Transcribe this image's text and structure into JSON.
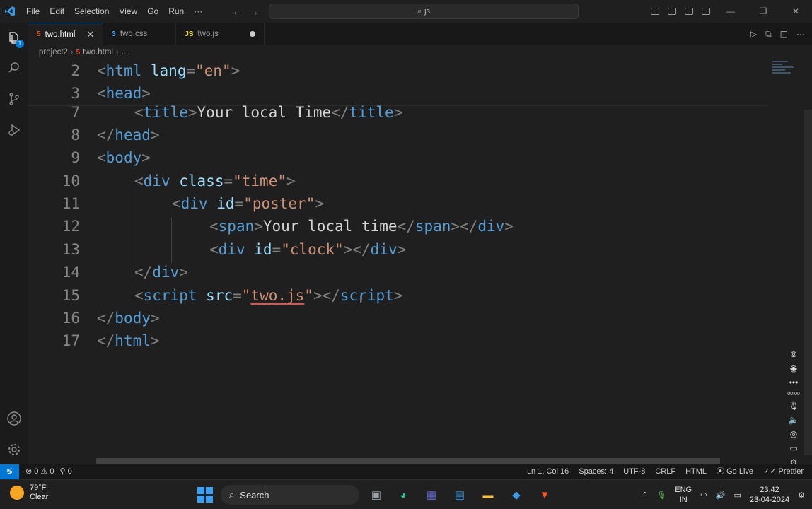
{
  "menu": [
    "File",
    "Edit",
    "Selection",
    "View",
    "Go",
    "Run",
    "···"
  ],
  "search": {
    "text": "js"
  },
  "tabs": [
    {
      "label": "two.html",
      "icon": "html-file-icon",
      "icon_color": "#e44d26"
    },
    {
      "label": "two.css",
      "icon": "css-file-icon",
      "icon_color": "#42a5f5"
    },
    {
      "label": "two.js",
      "icon": "js-file-icon",
      "icon_color": "#f1dd35"
    }
  ],
  "breadcrumb": {
    "folder": "project2",
    "file": "two.html",
    "more": "..."
  },
  "editor": {
    "lines": [
      {
        "n": "2",
        "indent": 0,
        "tokens": [
          [
            "p",
            "<"
          ],
          [
            "tag",
            "html"
          ],
          [
            "text",
            " "
          ],
          [
            "attr",
            "lang"
          ],
          [
            "p",
            "="
          ],
          [
            "str",
            "\"en\""
          ],
          [
            "p",
            ">"
          ]
        ]
      },
      {
        "n": "3",
        "indent": 0,
        "tokens": [
          [
            "p",
            "<"
          ],
          [
            "tag",
            "head"
          ],
          [
            "p",
            ">"
          ]
        ]
      },
      {
        "n": "7",
        "indent": 1,
        "tokens": [
          [
            "p",
            "<"
          ],
          [
            "tag",
            "title"
          ],
          [
            "p",
            ">"
          ],
          [
            "text",
            "Your local Time"
          ],
          [
            "p",
            "</"
          ],
          [
            "tag",
            "title"
          ],
          [
            "p",
            ">"
          ]
        ]
      },
      {
        "n": "8",
        "indent": 0,
        "tokens": [
          [
            "p",
            "</"
          ],
          [
            "tag",
            "head"
          ],
          [
            "p",
            ">"
          ]
        ]
      },
      {
        "n": "9",
        "indent": 0,
        "tokens": [
          [
            "p",
            "<"
          ],
          [
            "tag",
            "body"
          ],
          [
            "p",
            ">"
          ]
        ]
      },
      {
        "n": "10",
        "indent": 1,
        "tokens": [
          [
            "p",
            "<"
          ],
          [
            "tag",
            "div"
          ],
          [
            "text",
            " "
          ],
          [
            "attr",
            "class"
          ],
          [
            "p",
            "="
          ],
          [
            "str",
            "\"time\""
          ],
          [
            "p",
            ">"
          ]
        ]
      },
      {
        "n": "11",
        "indent": 2,
        "tokens": [
          [
            "p",
            "<"
          ],
          [
            "tag",
            "div"
          ],
          [
            "text",
            " "
          ],
          [
            "attr",
            "id"
          ],
          [
            "p",
            "="
          ],
          [
            "str",
            "\"poster\""
          ],
          [
            "p",
            ">"
          ]
        ]
      },
      {
        "n": "12",
        "indent": 3,
        "tokens": [
          [
            "p",
            "<"
          ],
          [
            "tag",
            "span"
          ],
          [
            "p",
            ">"
          ],
          [
            "text",
            "Your local time"
          ],
          [
            "p",
            "</"
          ],
          [
            "tag",
            "span"
          ],
          [
            "p",
            "></"
          ],
          [
            "tag",
            "div"
          ],
          [
            "p",
            ">"
          ]
        ]
      },
      {
        "n": "13",
        "indent": 3,
        "tokens": [
          [
            "p",
            "<"
          ],
          [
            "tag",
            "div"
          ],
          [
            "text",
            " "
          ],
          [
            "attr",
            "id"
          ],
          [
            "p",
            "="
          ],
          [
            "str",
            "\"clock\""
          ],
          [
            "p",
            "></"
          ],
          [
            "tag",
            "div"
          ],
          [
            "p",
            ">"
          ]
        ]
      },
      {
        "n": "14",
        "indent": 1,
        "tokens": [
          [
            "p",
            "</"
          ],
          [
            "tag",
            "div"
          ],
          [
            "p",
            ">"
          ]
        ]
      },
      {
        "n": "15",
        "indent": 1,
        "tokens": [
          [
            "p",
            "<"
          ],
          [
            "tag",
            "script"
          ],
          [
            "text",
            " "
          ],
          [
            "attr",
            "src"
          ],
          [
            "p",
            "="
          ],
          [
            "str",
            "\""
          ],
          [
            "strsq",
            "two.js"
          ],
          [
            "str",
            "\""
          ],
          [
            "p",
            "></"
          ],
          [
            "tag",
            "script"
          ],
          [
            "p",
            ">"
          ]
        ]
      },
      {
        "n": "16",
        "indent": 0,
        "tokens": [
          [
            "p",
            "</"
          ],
          [
            "tag",
            "body"
          ],
          [
            "p",
            ">"
          ]
        ]
      },
      {
        "n": "17",
        "indent": 0,
        "tokens": [
          [
            "p",
            "</"
          ],
          [
            "tag",
            "html"
          ],
          [
            "p",
            ">"
          ]
        ]
      }
    ]
  },
  "status": {
    "errors": "0",
    "warnings": "0",
    "ports": "0",
    "position": "Ln 1, Col 16",
    "spaces": "Spaces: 4",
    "encoding": "UTF-8",
    "eol": "CRLF",
    "language": "HTML",
    "golive": "Go Live",
    "prettier": "Prettier"
  },
  "recorder": {
    "time": "00:00"
  },
  "taskbar": {
    "temp": "79°F",
    "condition": "Clear",
    "search_label": "Search",
    "lang_top": "ENG",
    "lang_bottom": "IN",
    "time": "23:42",
    "date": "23-04-2024"
  },
  "colors": {
    "accent": "#0078d4",
    "tag": "#569cd6",
    "attr": "#9cdcfe",
    "string": "#ce9178"
  }
}
